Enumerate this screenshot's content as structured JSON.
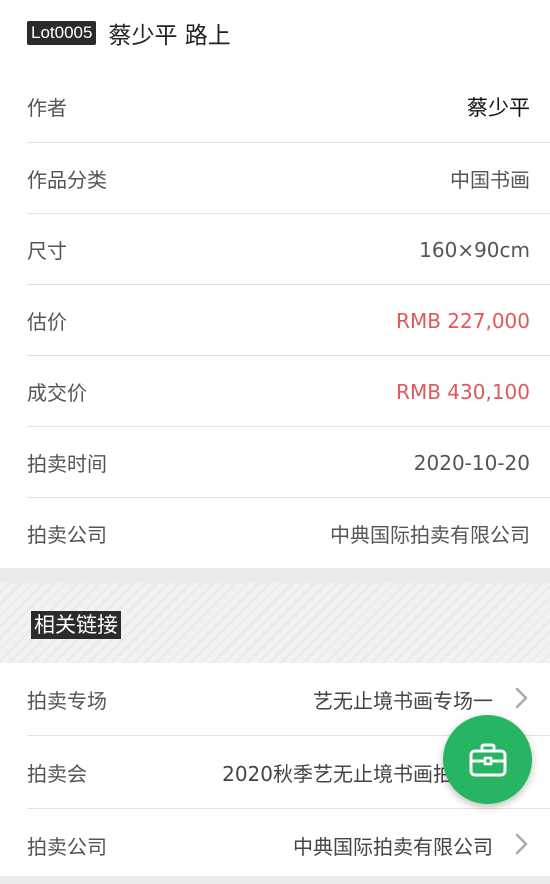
{
  "header": {
    "lot": "Lot0005",
    "title": "蔡少平 路上"
  },
  "details": [
    {
      "label": "作者",
      "value": "蔡少平"
    },
    {
      "label": "作品分类",
      "value": "中国书画"
    },
    {
      "label": "尺寸",
      "value": "160×90cm"
    },
    {
      "label": "估价",
      "value": "RMB 227,000"
    },
    {
      "label": "成交价",
      "value": "RMB 430,100"
    },
    {
      "label": "拍卖时间",
      "value": "2020-10-20"
    },
    {
      "label": "拍卖公司",
      "value": "中典国际拍卖有限公司"
    }
  ],
  "related": {
    "title": "相关链接",
    "items": [
      {
        "label": "拍卖专场",
        "value": "艺无止境书画专场一"
      },
      {
        "label": "拍卖会",
        "value": "2020秋季艺无止境书画拍卖会"
      },
      {
        "label": "拍卖公司",
        "value": "中典国际拍卖有限公司"
      }
    ]
  },
  "fab": {
    "icon": "briefcase-icon"
  },
  "colors": {
    "accent_red": "#e0585a",
    "fab_green": "#27b463"
  }
}
